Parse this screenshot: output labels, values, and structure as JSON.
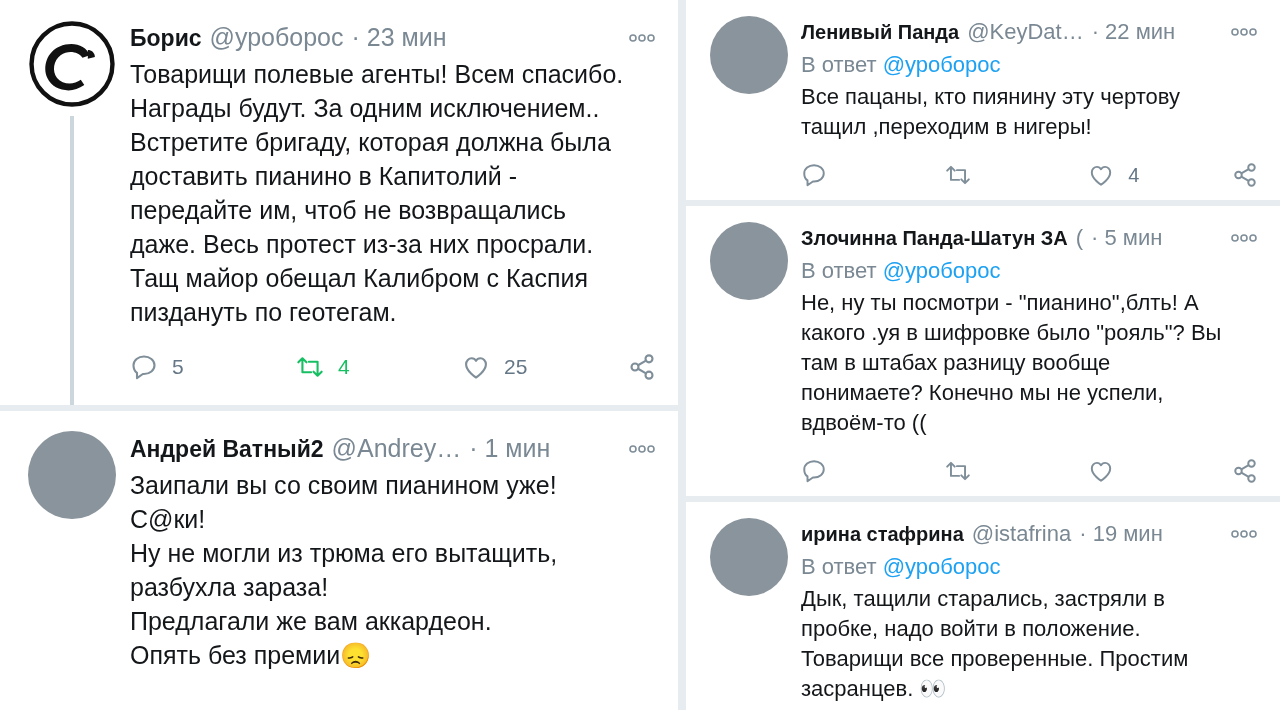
{
  "columns": [
    {
      "tweets": [
        {
          "avatar": {
            "kind": "logo"
          },
          "thread": true,
          "name": "Борис",
          "handle": "@уроборос",
          "time": "· 23 мин",
          "body": "Товарищи полевые агенты! Всем спасибо. Награды будут. За одним исключением.. Встретите бригаду, которая должна была доставить пианино в Капитолий - передайте им, чтоб не возвращались даже. Весь протест из-за них просрали. Тащ майор обещал Калибром с Каспия пиздануть по геотегам.",
          "actions": [
            {
              "kind": "reply",
              "count": "5",
              "active": false
            },
            {
              "kind": "retweet",
              "count": "4",
              "active": true
            },
            {
              "kind": "like",
              "count": "25",
              "active": false
            },
            {
              "kind": "share",
              "active": false
            }
          ]
        },
        {
          "avatar": {
            "kind": "photo"
          },
          "thread": false,
          "name": "Андрей Ватный2",
          "handle": "@Andrey…",
          "time": "· 1 мин",
          "body": "Заипали вы со своим пианином уже!\nС@ки!\nНу не могли из трюма его вытащить, разбухла зараза!\nПредлагали же вам аккардеон.\nОпять без премии😞"
        }
      ]
    },
    {
      "tweets": [
        {
          "avatar": {
            "kind": "photo"
          },
          "thread": false,
          "name": "Ленивый Панда",
          "handle": "@KeyDat…",
          "time": "· 22 мин",
          "reply_to": {
            "label": "В ответ",
            "handle": "@уроборос"
          },
          "body": "Все пацаны, кто пиянину эту чертову тащил ,переходим в нигеры!",
          "actions": [
            {
              "kind": "reply",
              "active": false
            },
            {
              "kind": "retweet",
              "active": false
            },
            {
              "kind": "like",
              "count": "4",
              "active": false
            },
            {
              "kind": "share",
              "active": false
            }
          ]
        },
        {
          "avatar": {
            "kind": "photo"
          },
          "thread": false,
          "name": "Злочинна Панда-Шатун ЗА",
          "handle": "(",
          "time": "· 5 мин",
          "reply_to": {
            "label": "В ответ",
            "handle": "@уроборос"
          },
          "body": "Не, ну ты посмотри - \"пианино\",блть! А какого .уя в шифровке было \"рояль\"? Вы там в штабах разницу вообще понимаете? Конечно мы не успели, вдвоём-то ((",
          "actions": [
            {
              "kind": "reply",
              "active": false
            },
            {
              "kind": "retweet",
              "active": false
            },
            {
              "kind": "like",
              "active": false
            },
            {
              "kind": "share",
              "active": false
            }
          ]
        },
        {
          "avatar": {
            "kind": "photo"
          },
          "thread": false,
          "name": "ирина стафрина",
          "handle": "@istafrina",
          "time": "· 19 мин",
          "reply_to": {
            "label": "В ответ",
            "handle": "@уроборос"
          },
          "body": "Дык, тащили старались, застряли в пробке, надо войти в положение. Товарищи все проверенные. Простим засранцев. 👀"
        }
      ]
    }
  ]
}
